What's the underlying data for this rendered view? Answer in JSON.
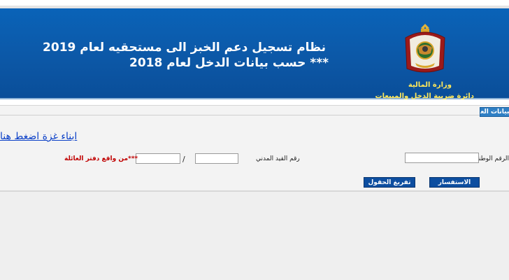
{
  "header": {
    "title_line1": "نظام تسجيل دعم الخبز الى مستحقيه لعام 2019",
    "title_line2": "***  حسب بيانات الدخل لعام 2018",
    "ministry": "وزارة المالية",
    "department": "دائرة ضريبة الدخل والمبيعات",
    "emblem_icon": "jordan-coat-of-arms-icon"
  },
  "tabs": [
    {
      "label": "البيانات العامة"
    }
  ],
  "children_link": "ابناء غزة اضغط هنا",
  "form": {
    "national_id_label": "الرقم الوطني :",
    "civil_registry_label": "رقم القيد المدني",
    "family_book_note": "***من واقع دفتر العائلة",
    "slash": "/"
  },
  "buttons": {
    "inquiry": "الاستفسار",
    "clear": "تفريغ الحقول"
  },
  "colors": {
    "banner": "#0c58a7",
    "header_text": "#ffffff",
    "ministry_text": "#ffe85a",
    "button": "#0d4ea0",
    "note": "#c00000",
    "link": "#0a3fc7"
  }
}
